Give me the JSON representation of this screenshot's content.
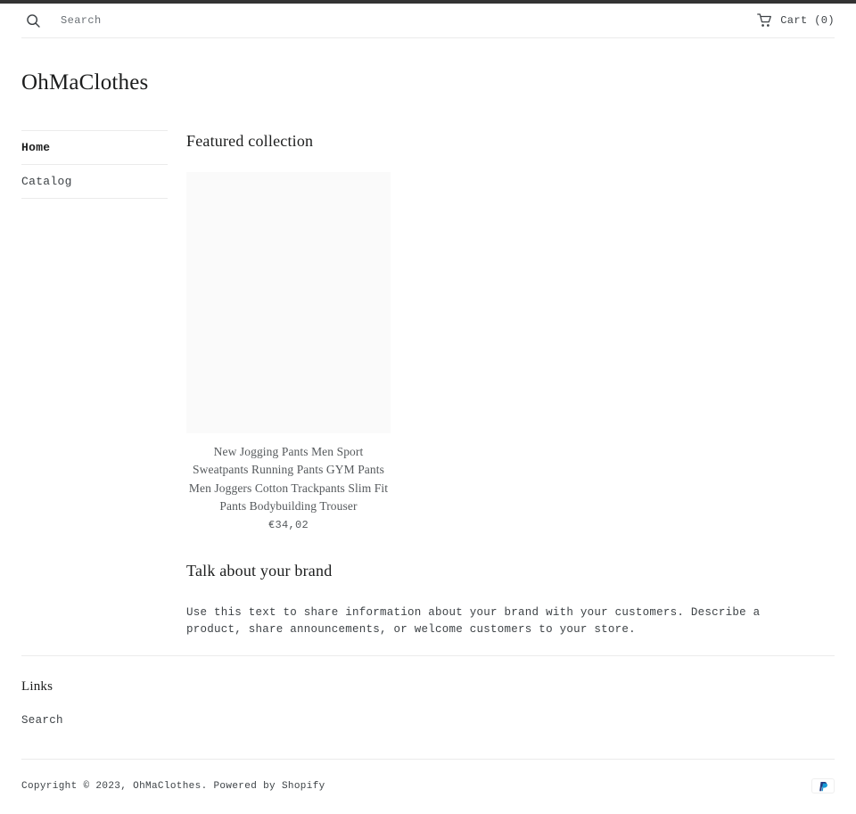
{
  "top_bar": {
    "color": "#333333"
  },
  "header": {
    "search_icon": "search-icon",
    "search_placeholder": "Search",
    "search_value": "",
    "cart_icon": "shopping-cart-icon",
    "cart_label": "Cart (0)"
  },
  "store": {
    "name": "OhMaClothes"
  },
  "sidebar": {
    "items": [
      {
        "label": "Home",
        "active": true
      },
      {
        "label": "Catalog",
        "active": false
      }
    ]
  },
  "main": {
    "featured_heading": "Featured collection",
    "products": [
      {
        "title": "New Jogging Pants Men Sport Sweatpants Running Pants GYM Pants Men Joggers Cotton Trackpants Slim Fit Pants Bodybuilding Trouser",
        "price": "€34,02",
        "image_placeholder_color": "#fafafa"
      }
    ],
    "brand_heading": "Talk about your brand",
    "brand_text": "Use this text to share information about your brand with your customers. Describe a product, share announcements, or welcome customers to your store."
  },
  "footer": {
    "links_heading": "Links",
    "links": [
      {
        "label": "Search"
      }
    ],
    "copyright": "Copyright © 2023, OhMaClothes. Powered by Shopify",
    "payment_icons": [
      {
        "name": "paypal-icon",
        "color": "#253B80"
      }
    ]
  }
}
